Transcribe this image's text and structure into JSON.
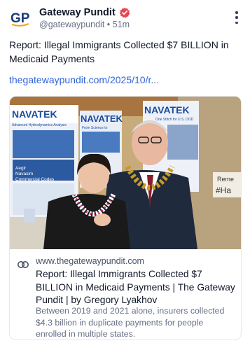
{
  "account": {
    "name": "Gateway Pundit",
    "handle": "@gatewaypundit",
    "separator": "•",
    "time": "51m",
    "avatar_text": "GP"
  },
  "post": {
    "text": "Report: Illegal Immigrants Collected $7 BILLION in Medicaid Payments",
    "link": "thegatewaypundit.com/2025/10/r..."
  },
  "link_card": {
    "domain": "www.thegatewaypundit.com",
    "title": "Report: Illegal Immigrants Collected $7 BILLION in Medicaid Payments | The Gateway Pundit | by Gregory Lyakhov",
    "description": "Between 2019 and 2021 alone, insurers collected $4.3 billion in duplicate payments for people enrolled in multiple states."
  },
  "photo": {
    "banner_left": "NAVATEK",
    "banner_left_sub": "Advanced Hydrodynamics Analysis",
    "banner_mid": "NAVATEK",
    "banner_mid_sub": "From Science to",
    "banner_right": "NAVATEK",
    "banner_right_sub": "One Stitch for U.S. DOD",
    "panel_text_1": "Aegir",
    "panel_text_2": "Navasim",
    "panel_text_3": "Commercial Codes",
    "sign_text_1": "Reme",
    "sign_text_2": "#Ha"
  },
  "icons": {
    "verified": "verified-badge-icon",
    "more": "more-options-icon",
    "link": "link-icon"
  },
  "colors": {
    "accent_link": "#2f63d6",
    "verified": "#e5484d",
    "navatek_blue": "#1b4a9c"
  }
}
